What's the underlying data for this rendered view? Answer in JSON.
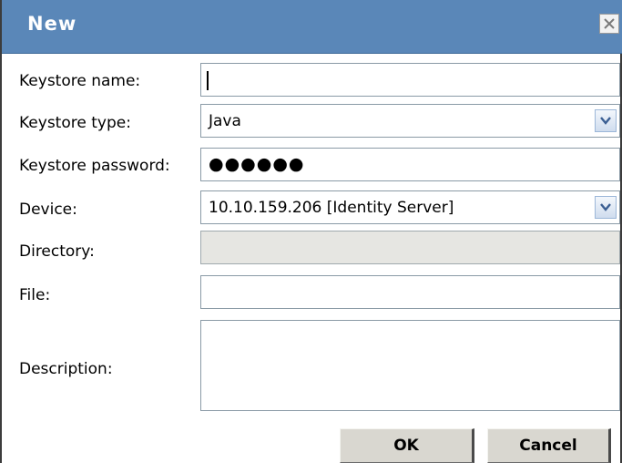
{
  "dialog": {
    "title": "New",
    "close_icon": "close-icon"
  },
  "form": {
    "keystore_name": {
      "label": "Keystore name:",
      "value": ""
    },
    "keystore_type": {
      "label": "Keystore type:",
      "value": "Java"
    },
    "keystore_password": {
      "label": "Keystore password:",
      "value": "●●●●●●"
    },
    "device": {
      "label": "Device:",
      "value": "10.10.159.206 [Identity Server]"
    },
    "directory": {
      "label": "Directory:",
      "value": ""
    },
    "file": {
      "label": "File:",
      "value": ""
    },
    "description": {
      "label": "Description:",
      "value": ""
    }
  },
  "buttons": {
    "ok": "OK",
    "cancel": "Cancel"
  }
}
